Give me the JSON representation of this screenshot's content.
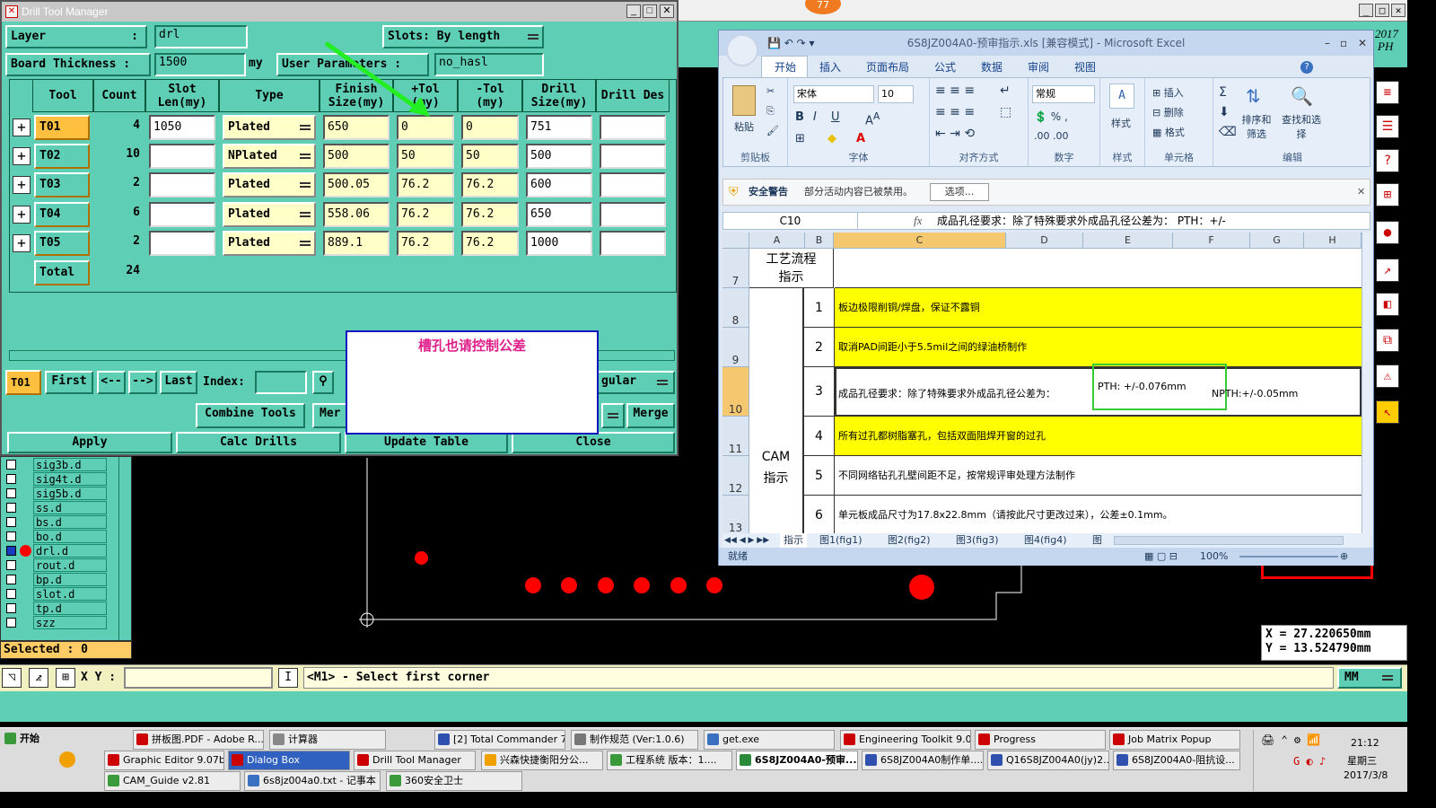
{
  "drill_manager": {
    "title": "Drill Tool Manager",
    "layer_label": "Layer",
    "layer_colon": ":",
    "layer_value": "drl",
    "slots_label": "Slots:",
    "slots_value": "By length",
    "board_thickness_label": "Board Thickness :",
    "board_thickness_value": "1500",
    "board_thickness_unit": "my",
    "user_params_label": "User Parameters :",
    "user_params_value": "no_hasl",
    "columns": [
      "Tool",
      "Count",
      "Slot Len(my)",
      "Type",
      "Finish Size(my)",
      "+Tol (my)",
      "-Tol (my)",
      "Drill Size(my)",
      "Drill Des"
    ],
    "rows": [
      {
        "tool": "T01",
        "count": "4",
        "slot_len": "1050",
        "type": "Plated",
        "finish": "650",
        "ptol": "0",
        "mtol": "0",
        "drill": "751",
        "des": ""
      },
      {
        "tool": "T02",
        "count": "10",
        "slot_len": "",
        "type": "NPlated",
        "finish": "500",
        "ptol": "50",
        "mtol": "50",
        "drill": "500",
        "des": ""
      },
      {
        "tool": "T03",
        "count": "2",
        "slot_len": "",
        "type": "Plated",
        "finish": "500.05",
        "ptol": "76.2",
        "mtol": "76.2",
        "drill": "600",
        "des": ""
      },
      {
        "tool": "T04",
        "count": "6",
        "slot_len": "",
        "type": "Plated",
        "finish": "558.06",
        "ptol": "76.2",
        "mtol": "76.2",
        "drill": "650",
        "des": ""
      },
      {
        "tool": "T05",
        "count": "2",
        "slot_len": "",
        "type": "Plated",
        "finish": "889.1",
        "ptol": "76.2",
        "mtol": "76.2",
        "drill": "1000",
        "des": ""
      }
    ],
    "total_label": "Total",
    "total_count": "24",
    "current_tool": "T01",
    "nav": {
      "first": "First",
      "prev": "<--",
      "next": "-->",
      "last": "Last",
      "index": "Index:"
    },
    "regular": "gular",
    "combine_tools": "Combine Tools",
    "merge_partial": "Mer",
    "merge": "Merge",
    "apply": "Apply",
    "calc_drills": "Calc Drills",
    "update_table": "Update Table",
    "close": "Close"
  },
  "dialog": {
    "text": "槽孔也请控制公差"
  },
  "layers": [
    "sig3b.d",
    "sig4t.d",
    "sig5b.d",
    "ss.d",
    "bs.d",
    "bo.d",
    "drl.d",
    "rout.d",
    "bp.d",
    "slot.d",
    "tp.d",
    "szz"
  ],
  "selected_label": "Selected : 0",
  "cmd": {
    "xy_label": "X Y :",
    "prompt": "<M1> - Select first corner",
    "units": "MM"
  },
  "coords": {
    "x": "X  =  27.220650mm",
    "y": "Y  =  13.524790mm"
  },
  "year_label": "2017",
  "ph_label": "PH",
  "badge": "77",
  "excel": {
    "title": "6S8JZ004A0-预审指示.xls [兼容模式] - Microsoft Excel",
    "tabs": [
      "开始",
      "插入",
      "页面布局",
      "公式",
      "数据",
      "审阅",
      "视图"
    ],
    "groups": [
      "剪贴板",
      "字体",
      "对齐方式",
      "数字",
      "样式",
      "单元格",
      "编辑"
    ],
    "paste": "粘贴",
    "font_name": "宋体",
    "font_size": "10",
    "number_format": "常规",
    "style": "样式",
    "insert": "插入",
    "delete": "删除",
    "format": "格式",
    "sort": "排序和筛选",
    "find": "查找和选择",
    "security_title": "安全警告",
    "security_msg": "部分活动内容已被禁用。",
    "options_btn": "选项...",
    "cell_ref": "C10",
    "fx": "fx",
    "formula": "成品孔径要求：除了特殊要求外成品孔径公差为：  PTH：+/-",
    "columns": [
      "A",
      "B",
      "C",
      "D",
      "E",
      "F",
      "G",
      "H"
    ],
    "row7_label": "工艺流程指示",
    "cam_label": "CAM指示",
    "rows": [
      {
        "row": "7",
        "num": "",
        "text": ""
      },
      {
        "row": "8",
        "num": "1",
        "text": "板边极限削铜/焊盘，保证不露铜"
      },
      {
        "row": "9",
        "num": "2",
        "text": "取消PAD间距小于5.5mil之间的绿油桥制作"
      },
      {
        "row": "10",
        "num": "3",
        "text": "成品孔径要求：除了特殊要求外成品孔径公差为：",
        "pth": "PTH: +/-0.076mm",
        "npth": "NPTH:+/-0.05mm"
      },
      {
        "row": "11",
        "num": "4",
        "text": "所有过孔都树脂塞孔，包括双面阻焊开窗的过孔"
      },
      {
        "row": "12",
        "num": "5",
        "text": "不同网络钻孔孔壁间距不足，按常规评审处理方法制作"
      },
      {
        "row": "13",
        "num": "6",
        "text": "单元板成品尺寸为17.8x22.8mm（请按此尺寸更改过来），公差±0.1mm。"
      }
    ],
    "sheets": [
      "指示",
      "图1(fig1)",
      "图2(fig2)",
      "图3(fig3)",
      "图4(fig4)",
      "图"
    ],
    "status": "就绪",
    "zoom": "100%"
  },
  "taskbar": {
    "start": "开始",
    "row1": [
      "拼板图.PDF - Adobe R...",
      "计算器",
      "[2] Total Commander 7...",
      "制作规范 (Ver:1.0.6)",
      "get.exe",
      "Engineering Toolkit 9.0...",
      "Progress",
      "Job Matrix Popup"
    ],
    "row2": [
      "Graphic Editor 9.07b...",
      "Dialog Box",
      "Drill Tool Manager",
      "兴森快捷衡阳分公...",
      "工程系统  版本：1....",
      "6S8JZ004A0-预审...",
      "6S8JZ004A0制作单....",
      "Q16S8JZ004A0(jy)2...",
      "6S8JZ004A0-阻抗设..."
    ],
    "row3": [
      "CAM_Guide v2.81",
      "6s8jz004a0.txt - 记事本",
      "360安全卫士"
    ],
    "time": "21:12",
    "weekday": "星期三",
    "date": "2017/3/8"
  },
  "colors": {
    "cam_teal": "#5ecfb4",
    "tool_orange": "#ffc040",
    "excel_yellow": "#ffff00",
    "dialog_text": "#e0208a",
    "highlight_green": "#33cc33"
  }
}
